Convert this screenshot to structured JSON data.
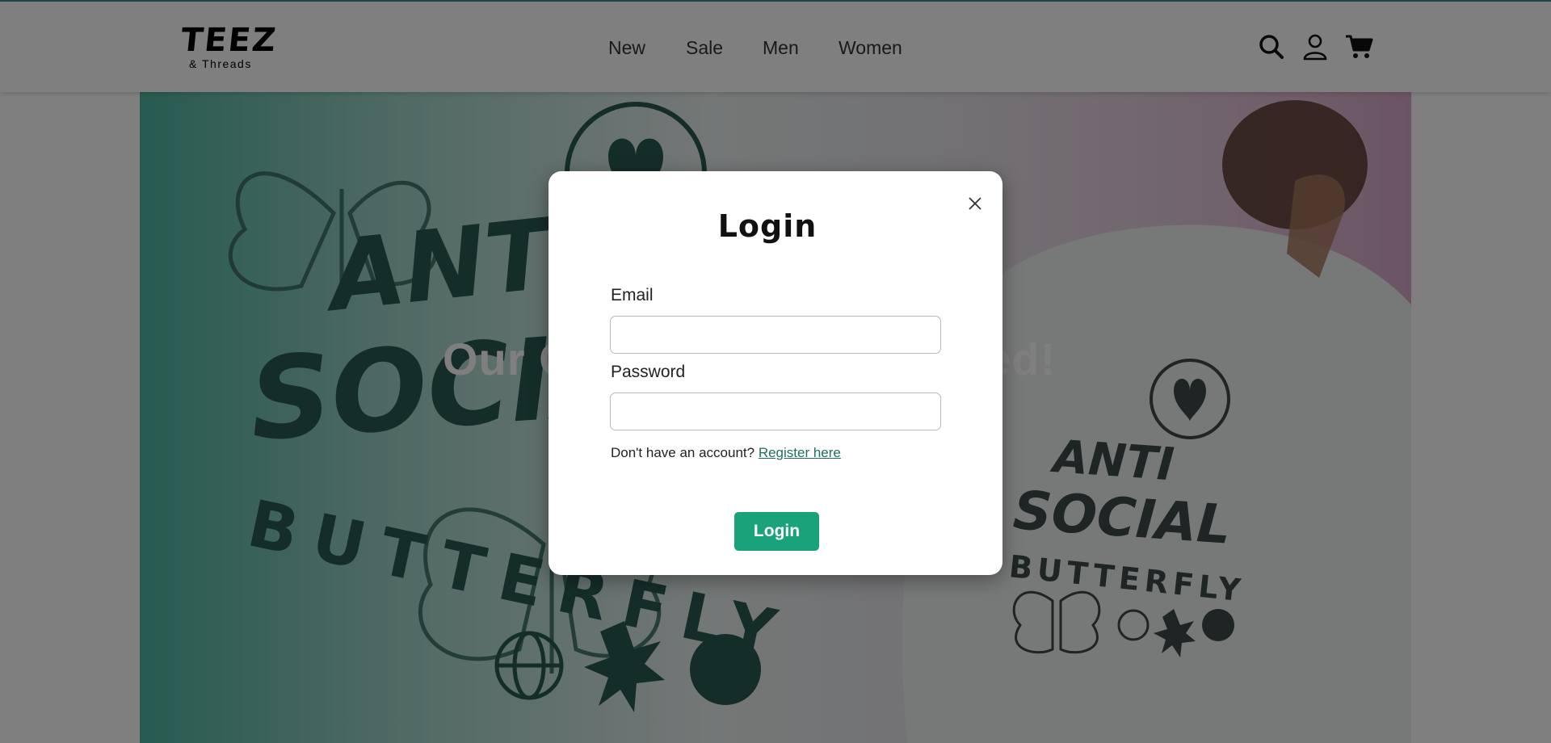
{
  "header": {
    "logo": {
      "main": "TEEZ",
      "sub": "& Threads"
    },
    "nav": [
      {
        "label": "New"
      },
      {
        "label": "Sale"
      },
      {
        "label": "Men"
      },
      {
        "label": "Women"
      }
    ],
    "icons": [
      "search-icon",
      "user-icon",
      "cart-icon"
    ]
  },
  "hero": {
    "headline": "Our Collection Has Arrived!",
    "shirt_print": {
      "line1": "ANTI",
      "line2": "SOCIAL",
      "line3": "BUTTERFLY"
    }
  },
  "login_modal": {
    "title": "Login",
    "email_label": "Email",
    "email_value": "",
    "password_label": "Password",
    "password_value": "",
    "register_prompt": "Don't have an account?",
    "register_link": "Register here",
    "submit_label": "Login",
    "close_icon": "close-icon"
  },
  "colors": {
    "accent": "#1aa37a",
    "header_border": "#2f8f8f",
    "link": "#1f6f5f"
  }
}
